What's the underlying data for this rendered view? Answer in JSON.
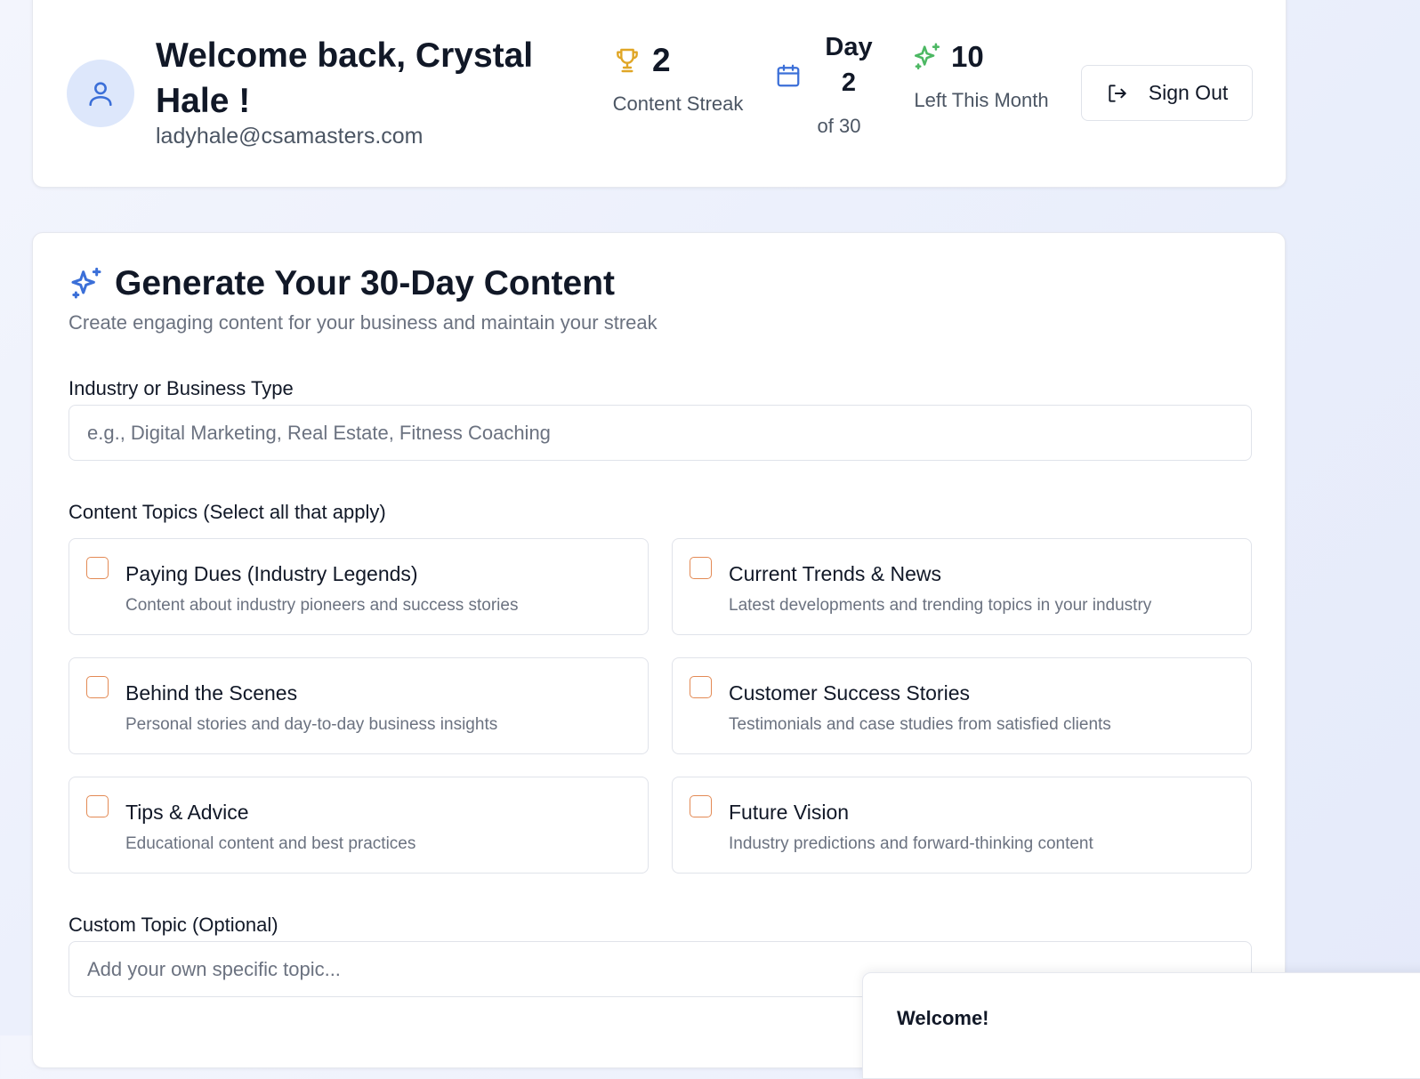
{
  "user": {
    "welcome": "Welcome back, Crystal Hale !",
    "email": "ladyhale@csamasters.com"
  },
  "stats": {
    "streak_value": "2",
    "streak_label": "Content Streak",
    "day_word": "Day",
    "day_value": "2",
    "day_of": "of 30",
    "left_value": "10",
    "left_label": "Left This Month"
  },
  "signout_label": "Sign Out",
  "generate": {
    "title": "Generate Your 30-Day Content",
    "subtitle": "Create engaging content for your business and maintain your streak",
    "industry_label": "Industry or Business Type",
    "industry_placeholder": "e.g., Digital Marketing, Real Estate, Fitness Coaching",
    "topics_label": "Content Topics (Select all that apply)",
    "topics": [
      {
        "title": "Paying Dues (Industry Legends)",
        "desc": "Content about industry pioneers and success stories",
        "checked": false
      },
      {
        "title": "Current Trends & News",
        "desc": "Latest developments and trending topics in your industry",
        "checked": false
      },
      {
        "title": "Behind the Scenes",
        "desc": "Personal stories and day-to-day business insights",
        "checked": false
      },
      {
        "title": "Customer Success Stories",
        "desc": "Testimonials and case studies from satisfied clients",
        "checked": false
      },
      {
        "title": "Tips & Advice",
        "desc": "Educational content and best practices",
        "checked": false
      },
      {
        "title": "Future Vision",
        "desc": "Industry predictions and forward-thinking content",
        "checked": false
      }
    ],
    "custom_label": "Custom Topic (Optional)",
    "custom_placeholder": "Add your own specific topic..."
  },
  "popup": {
    "title": "Welcome!"
  },
  "colors": {
    "accent_blue": "#3b6fd8",
    "trophy_gold": "#e0a626",
    "sparkle_green": "#4cb863",
    "checkbox_orange": "#e38a55"
  }
}
